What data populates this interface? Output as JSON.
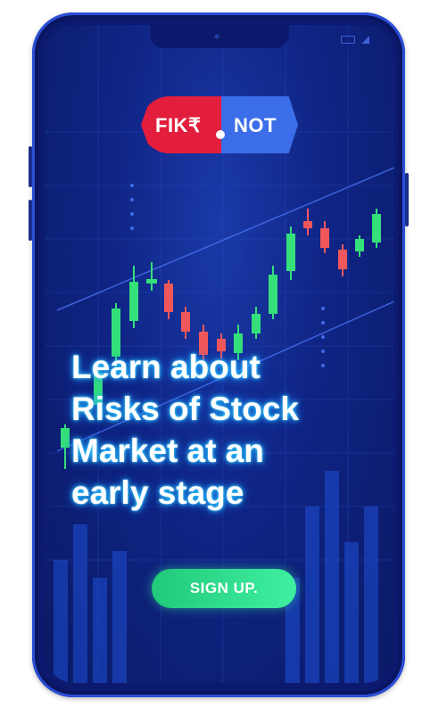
{
  "logo": {
    "left_text": "FIK₹",
    "right_text": "NOT"
  },
  "headline": {
    "line1": "Learn about",
    "line2": "Risks of Stock",
    "line3": "Market at an",
    "line4": "early stage"
  },
  "cta": {
    "signup_label": "SIGN UP."
  },
  "colors": {
    "brand_red": "#e21e3c",
    "brand_blue": "#3b6ee8",
    "cta_green": "#2fdb8c",
    "candle_up": "#35e07a",
    "candle_down": "#f0575a",
    "phone_body": "#0b1a6e"
  },
  "icons": {
    "status": [
      "battery-icon",
      "signal-icon"
    ],
    "camera": "camera-icon"
  }
}
